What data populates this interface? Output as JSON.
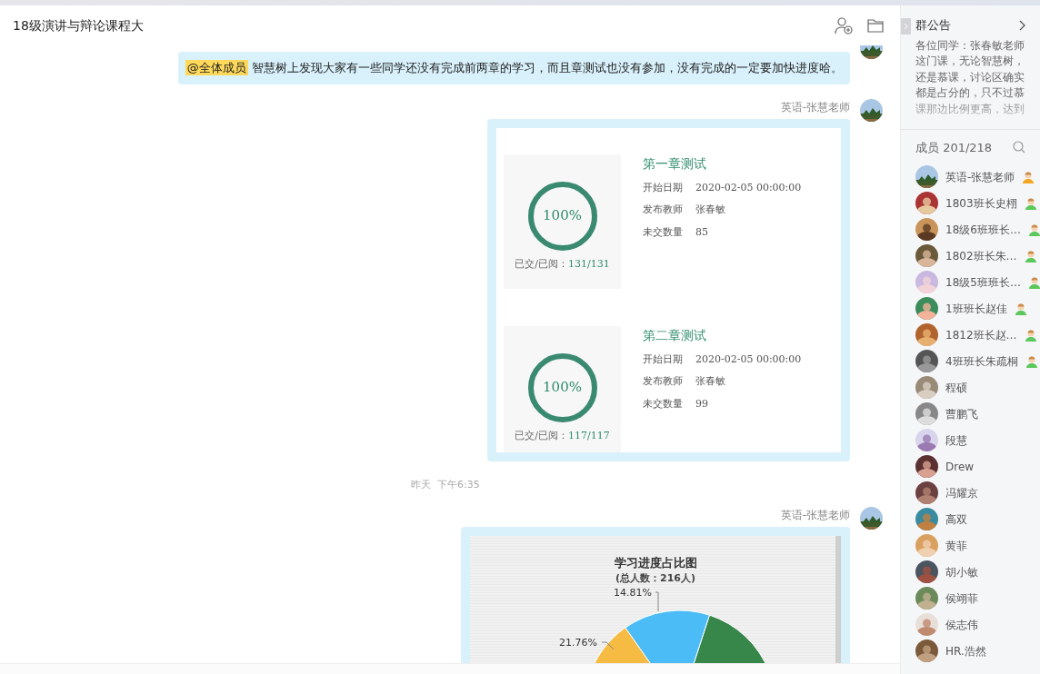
{
  "header": {
    "title": "18级演讲与辩论课程大"
  },
  "messages": [
    {
      "kind": "text",
      "mention": "@全体成员",
      "text": "智慧树上发现大家有一些同学还没有完成前两章的学习，而且章测试也没有参加，没有完成的一定要加快进度哈。"
    },
    {
      "kind": "tests",
      "sender": "英语-张慧老师",
      "tests": [
        {
          "title": "第一章测试",
          "percent": "100%",
          "level": 1,
          "ratio_label": "已交/已阅：",
          "ratio": "131/131",
          "fields": [
            {
              "label": "开始日期",
              "value": "2020-02-05 00:00:00"
            },
            {
              "label": "发布教师",
              "value": "张春敏"
            },
            {
              "label": "未交数量",
              "value": "85"
            }
          ]
        },
        {
          "title": "第二章测试",
          "percent": "100%",
          "level": 1,
          "ratio_label": "已交/已阅：",
          "ratio": "117/117",
          "fields": [
            {
              "label": "开始日期",
              "value": "2020-02-05 00:00:00"
            },
            {
              "label": "发布教师",
              "value": "张春敏"
            },
            {
              "label": "未交数量",
              "value": "99"
            }
          ]
        }
      ]
    },
    {
      "kind": "time",
      "day": "昨天",
      "time": "下午6:35"
    },
    {
      "kind": "chart",
      "sender": "英语-张慧老师",
      "title": "学习进度占比图",
      "subtitle": "(总人数：216人)",
      "labels": [
        "14.81%",
        "21.76%"
      ]
    }
  ],
  "sidebar": {
    "notice_title": "群公告",
    "notice": "各位同学：张春敏老师这门课，无论智慧树，还是慕课，讨论区确实都是占分的，只不过慕课那边比例更高，达到",
    "members_label": "成员",
    "members_count": "201/218",
    "members": [
      {
        "name": "英语-张慧老师",
        "kind": "owner"
      },
      {
        "name": "1803班长史栩",
        "kind": "admin"
      },
      {
        "name": "18级6班班长…",
        "kind": "admin"
      },
      {
        "name": "1802班长朱…",
        "kind": "admin"
      },
      {
        "name": "18级5班班长…",
        "kind": "admin"
      },
      {
        "name": "1班班长赵佳",
        "kind": "admin"
      },
      {
        "name": "1812班长赵…",
        "kind": "admin"
      },
      {
        "name": "4班班长朱疏桐",
        "kind": "admin"
      },
      {
        "name": "程硕",
        "kind": "member"
      },
      {
        "name": "曹鹏飞",
        "kind": "member"
      },
      {
        "name": "段慧",
        "kind": "member"
      },
      {
        "name": "Drew",
        "kind": "member"
      },
      {
        "name": "冯耀京",
        "kind": "member"
      },
      {
        "name": "高双",
        "kind": "member"
      },
      {
        "name": "黄菲",
        "kind": "member"
      },
      {
        "name": "胡小敏",
        "kind": "member"
      },
      {
        "name": "侯翊菲",
        "kind": "member"
      },
      {
        "name": "侯志伟",
        "kind": "member"
      },
      {
        "name": "HR.浩然",
        "kind": "member"
      }
    ]
  }
}
